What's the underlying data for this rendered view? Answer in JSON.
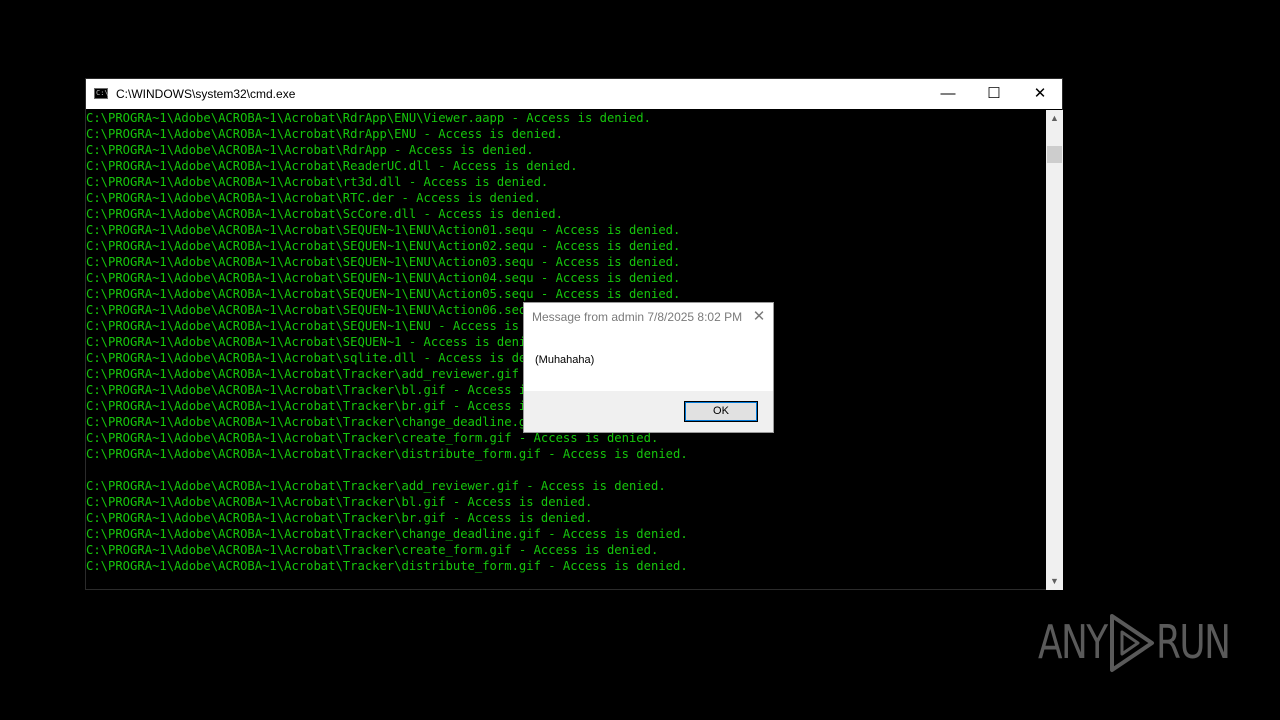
{
  "window": {
    "title": "C:\\WINDOWS\\system32\\cmd.exe",
    "icon": "cmd-icon",
    "icon_text": "C:\\",
    "minimize_glyph": "—",
    "maximize_glyph": "☐",
    "close_glyph": "✕"
  },
  "console": {
    "text_color": "#16c60c",
    "lines": [
      "C:\\PROGRA~1\\Adobe\\ACROBA~1\\Acrobat\\RdrApp\\ENU\\Viewer.aapp - Access is denied.",
      "C:\\PROGRA~1\\Adobe\\ACROBA~1\\Acrobat\\RdrApp\\ENU - Access is denied.",
      "C:\\PROGRA~1\\Adobe\\ACROBA~1\\Acrobat\\RdrApp - Access is denied.",
      "C:\\PROGRA~1\\Adobe\\ACROBA~1\\Acrobat\\ReaderUC.dll - Access is denied.",
      "C:\\PROGRA~1\\Adobe\\ACROBA~1\\Acrobat\\rt3d.dll - Access is denied.",
      "C:\\PROGRA~1\\Adobe\\ACROBA~1\\Acrobat\\RTC.der - Access is denied.",
      "C:\\PROGRA~1\\Adobe\\ACROBA~1\\Acrobat\\ScCore.dll - Access is denied.",
      "C:\\PROGRA~1\\Adobe\\ACROBA~1\\Acrobat\\SEQUEN~1\\ENU\\Action01.sequ - Access is denied.",
      "C:\\PROGRA~1\\Adobe\\ACROBA~1\\Acrobat\\SEQUEN~1\\ENU\\Action02.sequ - Access is denied.",
      "C:\\PROGRA~1\\Adobe\\ACROBA~1\\Acrobat\\SEQUEN~1\\ENU\\Action03.sequ - Access is denied.",
      "C:\\PROGRA~1\\Adobe\\ACROBA~1\\Acrobat\\SEQUEN~1\\ENU\\Action04.sequ - Access is denied.",
      "C:\\PROGRA~1\\Adobe\\ACROBA~1\\Acrobat\\SEQUEN~1\\ENU\\Action05.sequ - Access is denied.",
      "C:\\PROGRA~1\\Adobe\\ACROBA~1\\Acrobat\\SEQUEN~1\\ENU\\Action06.sequ - Access is denied.",
      "C:\\PROGRA~1\\Adobe\\ACROBA~1\\Acrobat\\SEQUEN~1\\ENU - Access is denied.",
      "C:\\PROGRA~1\\Adobe\\ACROBA~1\\Acrobat\\SEQUEN~1 - Access is denied.",
      "C:\\PROGRA~1\\Adobe\\ACROBA~1\\Acrobat\\sqlite.dll - Access is denied.",
      "C:\\PROGRA~1\\Adobe\\ACROBA~1\\Acrobat\\Tracker\\add_reviewer.gif - Access is denied.",
      "C:\\PROGRA~1\\Adobe\\ACROBA~1\\Acrobat\\Tracker\\bl.gif - Access is denied.",
      "C:\\PROGRA~1\\Adobe\\ACROBA~1\\Acrobat\\Tracker\\br.gif - Access is denied.",
      "C:\\PROGRA~1\\Adobe\\ACROBA~1\\Acrobat\\Tracker\\change_deadline.gif - Access is denied.",
      "C:\\PROGRA~1\\Adobe\\ACROBA~1\\Acrobat\\Tracker\\create_form.gif - Access is denied.",
      "C:\\PROGRA~1\\Adobe\\ACROBA~1\\Acrobat\\Tracker\\distribute_form.gif - Access is denied.",
      "",
      "C:\\PROGRA~1\\Adobe\\ACROBA~1\\Acrobat\\Tracker\\add_reviewer.gif - Access is denied.",
      "C:\\PROGRA~1\\Adobe\\ACROBA~1\\Acrobat\\Tracker\\bl.gif - Access is denied.",
      "C:\\PROGRA~1\\Adobe\\ACROBA~1\\Acrobat\\Tracker\\br.gif - Access is denied.",
      "C:\\PROGRA~1\\Adobe\\ACROBA~1\\Acrobat\\Tracker\\change_deadline.gif - Access is denied.",
      "C:\\PROGRA~1\\Adobe\\ACROBA~1\\Acrobat\\Tracker\\create_form.gif - Access is denied.",
      "C:\\PROGRA~1\\Adobe\\ACROBA~1\\Acrobat\\Tracker\\distribute_form.gif - Access is denied."
    ]
  },
  "scrollbar": {
    "up_glyph": "▲",
    "down_glyph": "▼"
  },
  "message_box": {
    "title": "Message from admin 7/8/2025 8:02 PM",
    "close_glyph": "✕",
    "message": "(Muhahaha)",
    "ok_label": "OK"
  },
  "watermark": {
    "left_text": "ANY",
    "right_text": "RUN",
    "color": "#5a5a5a"
  }
}
